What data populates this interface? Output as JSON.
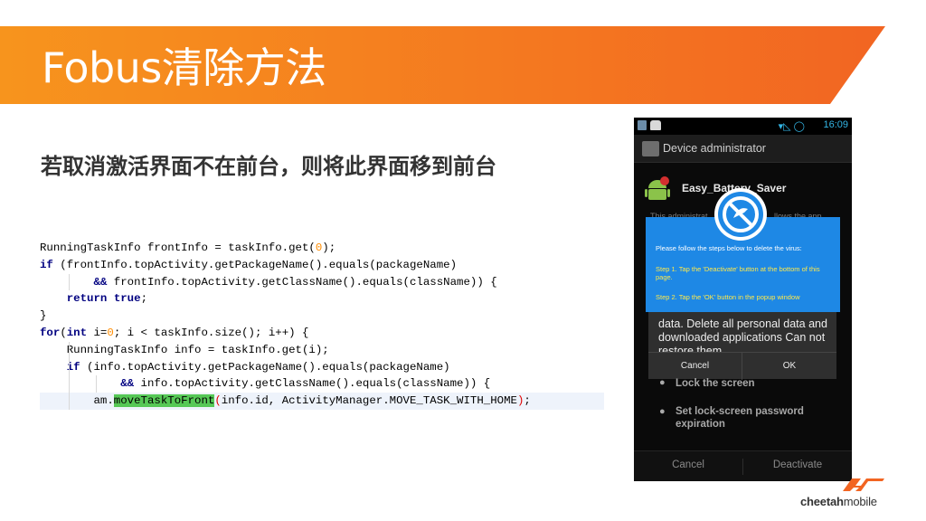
{
  "slide": {
    "title": "Fobus清除方法",
    "subtitle": "若取消激活界面不在前台，则将此界面移到前台",
    "colors": {
      "banner_start": "#f7941d",
      "banner_end": "#f26522",
      "overlay_blue": "#1e88e5",
      "highlight_green": "#56c856"
    }
  },
  "code": {
    "lines": [
      {
        "segments": [
          {
            "t": "RunningTaskInfo frontInfo = taskInfo.get("
          },
          {
            "t": "0",
            "c": "num"
          },
          {
            "t": ");"
          }
        ]
      },
      {
        "segments": [
          {
            "t": "if",
            "c": "kw"
          },
          {
            "t": " (frontInfo.topActivity.getPackageName().equals(packageName)"
          }
        ]
      },
      {
        "guides": [
          1
        ],
        "segments": [
          {
            "t": "        "
          },
          {
            "t": "&&",
            "c": "kw"
          },
          {
            "t": " frontInfo.topActivity.getClassName().equals(className)) {"
          }
        ]
      },
      {
        "guides": [],
        "segments": [
          {
            "t": "    "
          },
          {
            "t": "return",
            "c": "kw"
          },
          {
            "t": " "
          },
          {
            "t": "true",
            "c": "kw"
          },
          {
            "t": ";"
          }
        ]
      },
      {
        "segments": [
          {
            "t": "}"
          }
        ]
      },
      {
        "segments": [
          {
            "t": "for",
            "c": "kw"
          },
          {
            "t": "("
          },
          {
            "t": "int",
            "c": "kw"
          },
          {
            "t": " i="
          },
          {
            "t": "0",
            "c": "num"
          },
          {
            "t": "; i < taskInfo.size(); i++) {"
          }
        ]
      },
      {
        "guides": [
          1
        ],
        "segments": [
          {
            "t": "    RunningTaskInfo info = taskInfo.get(i);"
          }
        ]
      },
      {
        "guides": [
          1
        ],
        "segments": [
          {
            "t": "    "
          },
          {
            "t": "if",
            "c": "kw"
          },
          {
            "t": " (info.topActivity.getPackageName().equals(packageName)"
          }
        ]
      },
      {
        "guides": [
          1,
          2
        ],
        "segments": [
          {
            "t": "            "
          },
          {
            "t": "&&",
            "c": "kw"
          },
          {
            "t": " info.topActivity.getClassName().equals(className)) {"
          }
        ]
      },
      {
        "guides": [
          1
        ],
        "highlight": true,
        "segments": [
          {
            "t": "        am."
          },
          {
            "t": "moveTaskToFront",
            "c": "mhl"
          },
          {
            "t": "(",
            "c": "paren"
          },
          {
            "t": "info.id, ActivityManager.MOVE_TASK_WITH_HOME"
          },
          {
            "t": ")",
            "c": "paren"
          },
          {
            "t": ";"
          }
        ]
      }
    ]
  },
  "phone": {
    "status_time": "16:09",
    "action_title": "Device administrator",
    "app_name": "Easy_Battery_Saver",
    "bg_text_left": "This administrat",
    "bg_text_right": "llows the app",
    "dialog_text": "data. Delete all personal data and downloaded applications Can not restore them.",
    "dialog_cancel": "Cancel",
    "dialog_ok": "OK",
    "list": [
      "Lock the screen",
      "Set lock-screen password expiration"
    ],
    "bottom_cancel": "Cancel",
    "bottom_deactivate": "Deactivate"
  },
  "overlay": {
    "line1": "Please follow the steps below to delete the virus:",
    "line2": "Step 1. Tap the 'Deactivate' button at the bottom of this page.",
    "line3": "Step 2. Tap the 'OK' button in the popup window"
  },
  "logo": {
    "brand_bold": "cheetah",
    "brand_rest": "mobile"
  }
}
